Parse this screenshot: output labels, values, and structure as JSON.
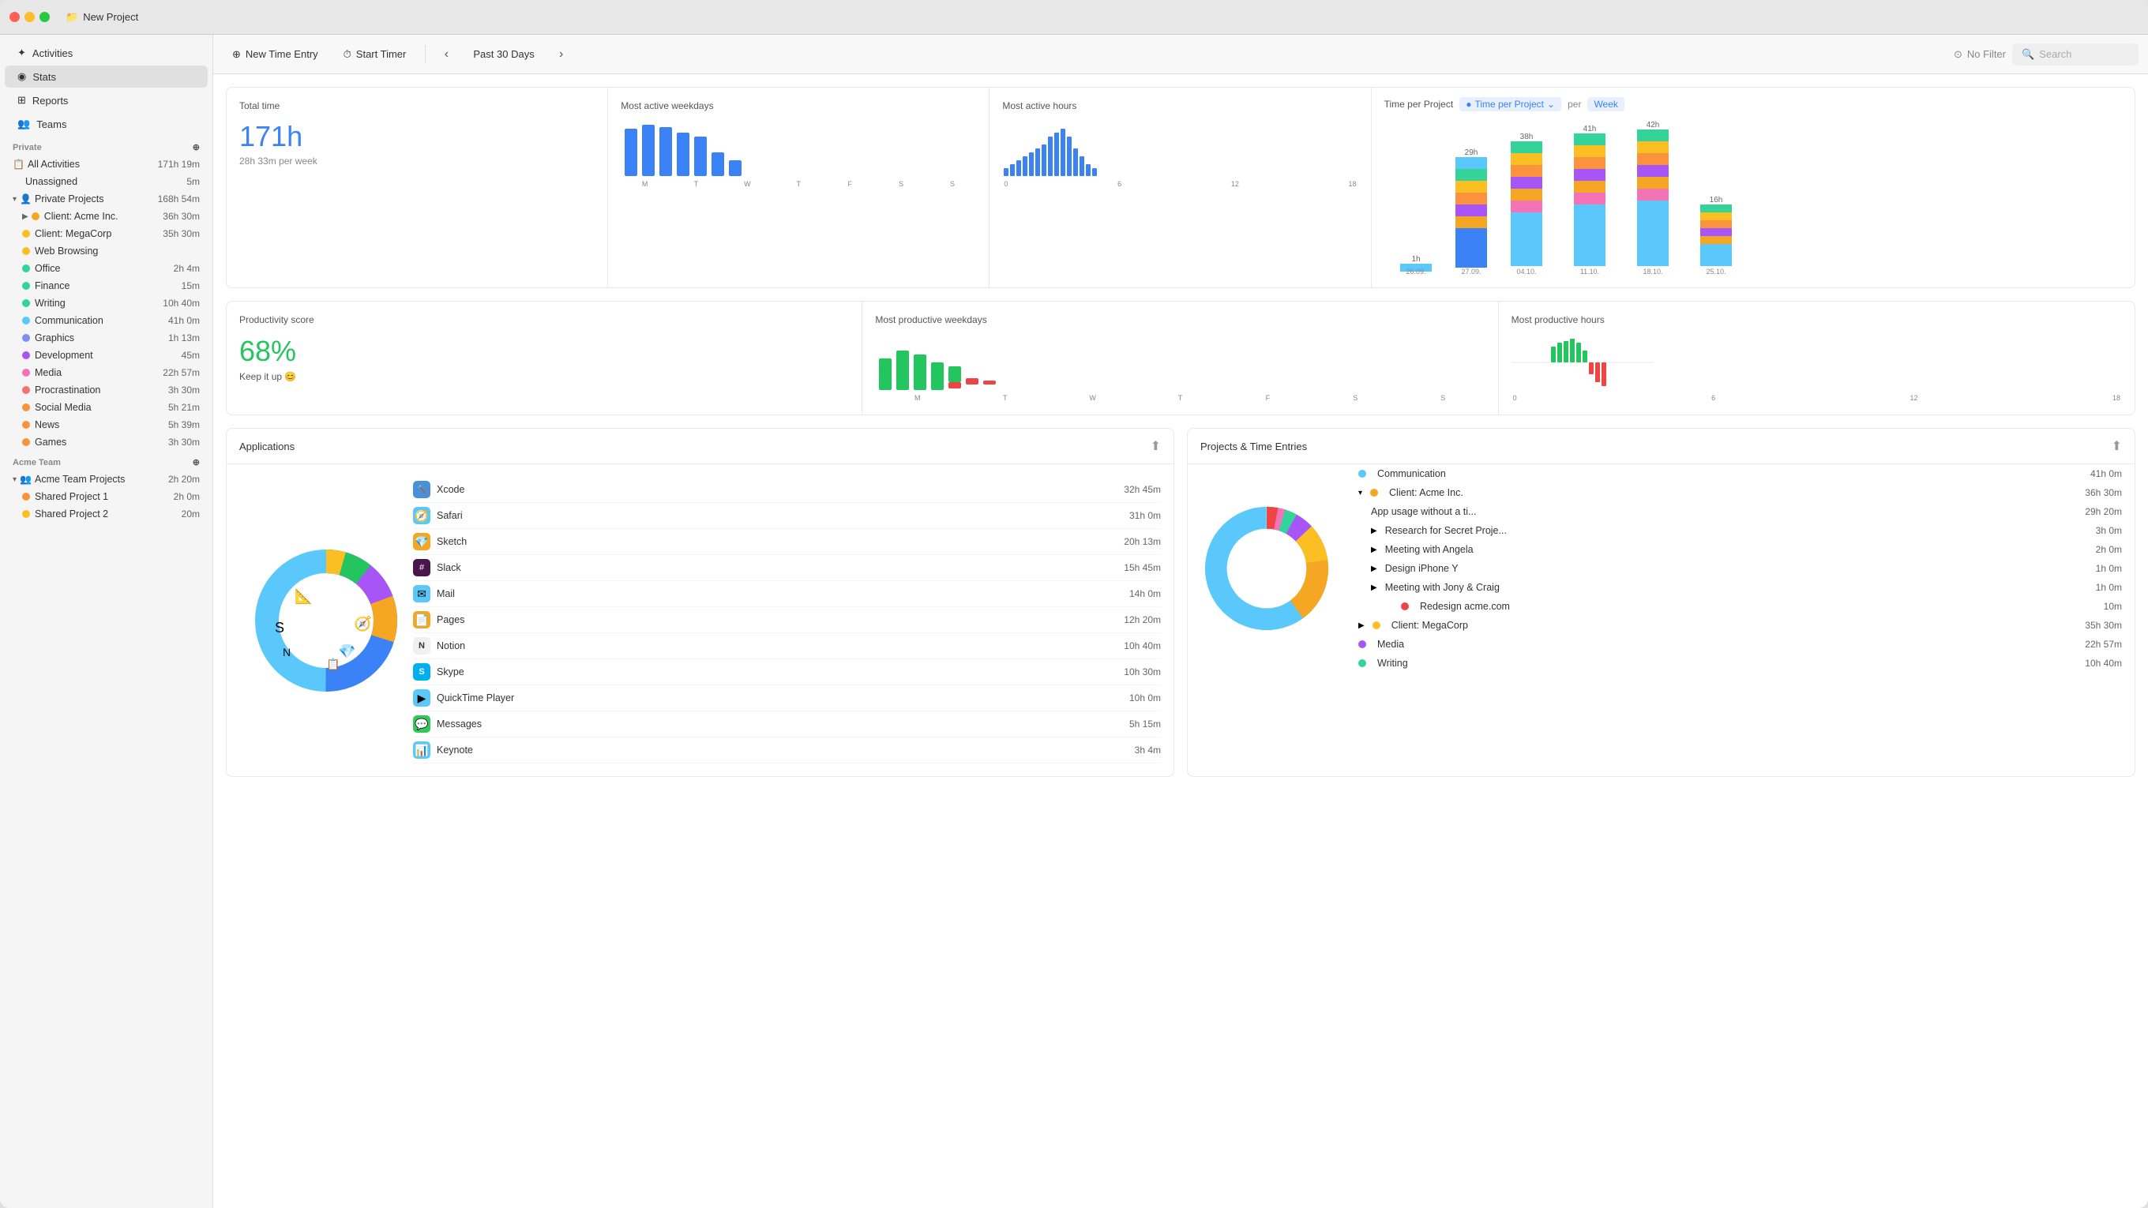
{
  "window": {
    "title": "New Project"
  },
  "toolbar": {
    "new_time_entry": "New Time Entry",
    "start_timer": "Start Timer",
    "period": "Past 30 Days",
    "filter": "No Filter",
    "search_placeholder": "Search"
  },
  "sidebar": {
    "nav_items": [
      {
        "id": "activities",
        "label": "Activities",
        "icon": "✦"
      },
      {
        "id": "stats",
        "label": "Stats",
        "icon": "◉",
        "active": true
      },
      {
        "id": "reports",
        "label": "Reports",
        "icon": "⊞"
      },
      {
        "id": "teams",
        "label": "Teams",
        "icon": "👥"
      }
    ],
    "private_section": "Private",
    "all_activities": {
      "label": "All Activities",
      "time": "171h 19m"
    },
    "unassigned": {
      "label": "Unassigned",
      "time": "5m"
    },
    "private_projects": {
      "label": "Private Projects",
      "time": "168h 54m"
    },
    "client_acme": {
      "label": "Client: Acme Inc.",
      "time": "36h 30m"
    },
    "client_megacorp": {
      "label": "Client: MegaCorp",
      "time": "35h 30m"
    },
    "web_browsing": {
      "label": "Web Browsing",
      "time": ""
    },
    "office": {
      "label": "Office",
      "time": "2h 4m"
    },
    "finance": {
      "label": "Finance",
      "time": "15m"
    },
    "writing": {
      "label": "Writing",
      "time": "10h 40m"
    },
    "communication": {
      "label": "Communication",
      "time": "41h 0m"
    },
    "graphics": {
      "label": "Graphics",
      "time": "1h 13m"
    },
    "development": {
      "label": "Development",
      "time": "45m"
    },
    "media": {
      "label": "Media",
      "time": "22h 57m"
    },
    "procrastination": {
      "label": "Procrastination",
      "time": "3h 30m"
    },
    "social_media": {
      "label": "Social Media",
      "time": "5h 21m"
    },
    "news": {
      "label": "News",
      "time": "5h 39m"
    },
    "games": {
      "label": "Games",
      "time": "3h 30m"
    },
    "acme_team_section": "Acme Team",
    "acme_team_projects": {
      "label": "Acme Team Projects",
      "time": "2h 20m"
    },
    "shared_project_1": {
      "label": "Shared Project 1",
      "time": "2h 0m"
    },
    "shared_project_2": {
      "label": "Shared Project 2",
      "time": "20m"
    }
  },
  "stats": {
    "total_time_label": "Total time",
    "total_time_value": "171h",
    "total_time_per_week": "28h 33m",
    "total_time_per_week_suffix": " per week",
    "most_active_weekdays_label": "Most active weekdays",
    "most_active_hours_label": "Most active hours",
    "productivity_score_label": "Productivity score",
    "productivity_score_value": "68%",
    "productivity_score_sub": "Keep it up 😊",
    "most_productive_weekdays_label": "Most productive weekdays",
    "most_productive_hours_label": "Most productive hours",
    "time_per_project_label": "Time per Project",
    "per_label": "per",
    "week_label": "Week",
    "applications_label": "Applications",
    "projects_time_entries_label": "Projects & Time Entries"
  },
  "time_per_project": {
    "bars": [
      {
        "label": "26.09.\n–26.09.",
        "value": "1h",
        "height": 20
      },
      {
        "label": "27.09.\n–03.10.",
        "value": "29h",
        "height": 120
      },
      {
        "label": "04.10.\n–10.10.",
        "value": "38h",
        "height": 155
      },
      {
        "label": "11.10.\n–17.10.",
        "value": "41h",
        "height": 165
      },
      {
        "label": "18.10.\n–24.10.",
        "value": "42h",
        "height": 170
      },
      {
        "label": "25.10.\n–26.10.",
        "value": "16h",
        "height": 65
      }
    ]
  },
  "applications": [
    {
      "name": "Xcode",
      "time": "32h 45m",
      "color": "#4a90d9",
      "icon": "🔨"
    },
    {
      "name": "Safari",
      "time": "31h 0m",
      "color": "#5ac8fa",
      "icon": "🧭"
    },
    {
      "name": "Sketch",
      "time": "20h 13m",
      "color": "#f5a623",
      "icon": "💎"
    },
    {
      "name": "Slack",
      "time": "15h 45m",
      "color": "#4a154b",
      "icon": "#"
    },
    {
      "name": "Mail",
      "time": "14h 0m",
      "color": "#5ac8fa",
      "icon": "✉"
    },
    {
      "name": "Pages",
      "time": "12h 20m",
      "color": "#f5a623",
      "icon": "📄"
    },
    {
      "name": "Notion",
      "time": "10h 40m",
      "color": "#333",
      "icon": "N"
    },
    {
      "name": "Skype",
      "time": "10h 30m",
      "color": "#00aff0",
      "icon": "S"
    },
    {
      "name": "QuickTime Player",
      "time": "10h 0m",
      "color": "#5ac8fa",
      "icon": "▶"
    },
    {
      "name": "Messages",
      "time": "5h 15m",
      "color": "#34c759",
      "icon": "💬"
    },
    {
      "name": "Keynote",
      "time": "3h 4m",
      "color": "#5ac8fa",
      "icon": "📊"
    }
  ],
  "projects": [
    {
      "label": "Communication",
      "time": "41h 0m",
      "color": "#5ac8fa",
      "indent": 0
    },
    {
      "label": "Client: Acme Inc.",
      "time": "36h 30m",
      "color": "#f5a623",
      "indent": 0,
      "expanded": true
    },
    {
      "label": "App usage without a ti...",
      "time": "29h 20m",
      "color": "",
      "indent": 1
    },
    {
      "label": "Research for Secret Proje...",
      "time": "3h 0m",
      "color": "",
      "indent": 1
    },
    {
      "label": "Meeting with Angela",
      "time": "2h 0m",
      "color": "",
      "indent": 1
    },
    {
      "label": "Design iPhone Y",
      "time": "1h 0m",
      "color": "",
      "indent": 1
    },
    {
      "label": "Meeting with Jony & Craig",
      "time": "1h 0m",
      "color": "",
      "indent": 1
    },
    {
      "label": "Redesign acme.com",
      "time": "10m",
      "color": "#ef4444",
      "indent": 2
    },
    {
      "label": "Client: MegaCorp",
      "time": "35h 30m",
      "color": "#fbbf24",
      "indent": 0
    },
    {
      "label": "Media",
      "time": "22h 57m",
      "color": "#a855f7",
      "indent": 0
    },
    {
      "label": "Writing",
      "time": "10h 40m",
      "color": "#34d399",
      "indent": 0
    }
  ],
  "colors": {
    "blue": "#3b82f6",
    "green": "#22c55e",
    "red": "#ef4444",
    "accent": "#3b82f6"
  }
}
